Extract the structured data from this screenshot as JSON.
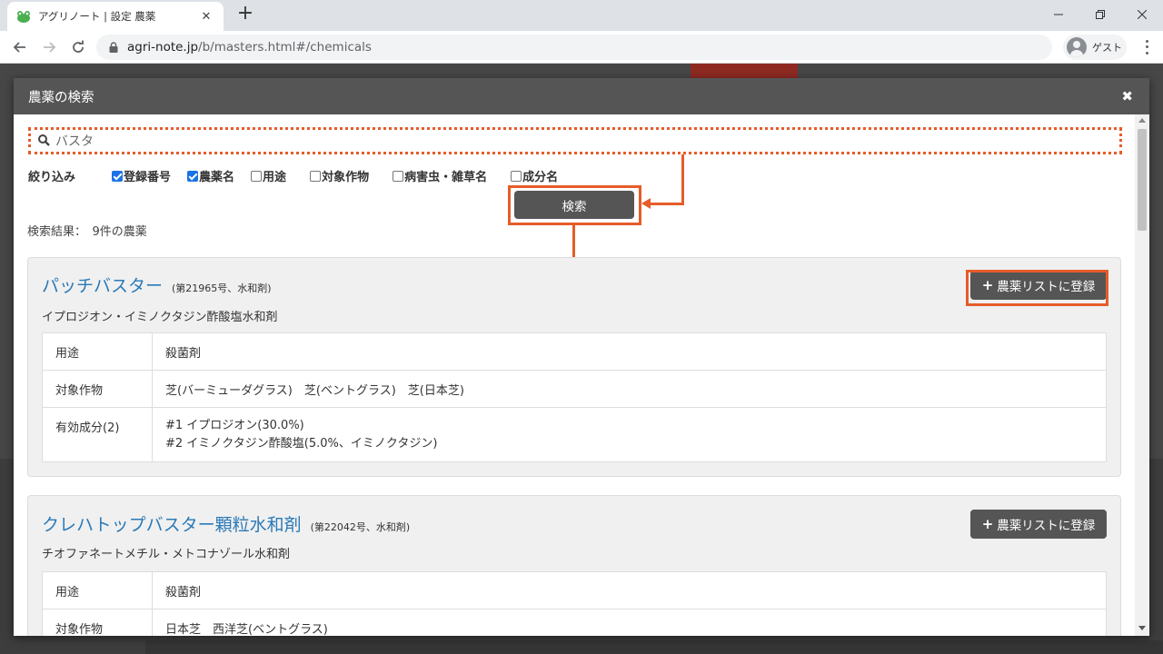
{
  "browser": {
    "tab_title": "アグリノート | 設定 農薬",
    "url_host": "agri-note.jp",
    "url_path": "/b/masters.html#/chemicals",
    "profile_label": "ゲスト"
  },
  "modal": {
    "title": "農薬の検索",
    "search_value": "バスタ",
    "filter_label": "絞り込み",
    "filters": [
      {
        "label": "登録番号",
        "checked": true
      },
      {
        "label": "農薬名",
        "checked": true
      },
      {
        "label": "用途",
        "checked": false
      },
      {
        "label": "対象作物",
        "checked": false
      },
      {
        "label": "病害虫・雑草名",
        "checked": false
      },
      {
        "label": "成分名",
        "checked": false
      }
    ],
    "search_button": "検索",
    "result_count": "検索結果：　9件の農薬",
    "add_button_label": "農薬リストに登録"
  },
  "results": [
    {
      "name": "パッチバスター",
      "registration": "(第21965号、水和剤)",
      "formulation": "イプロジオン・イミノクタジン酢酸塩水和剤",
      "rows": [
        {
          "key": "用途",
          "value": "殺菌剤"
        },
        {
          "key": "対象作物",
          "value": "芝(バーミューダグラス)　芝(ベントグラス)　芝(日本芝)"
        },
        {
          "key": "有効成分(2)",
          "value": "#1 イプロジオン(30.0%)",
          "value2": "#2 イミノクタジン酢酸塩(5.0%、イミノクタジン)"
        }
      ]
    },
    {
      "name": "クレハトップバスター顆粒水和剤",
      "registration": "(第22042号、水和剤)",
      "formulation": "チオファネートメチル・メトコナゾール水和剤",
      "rows": [
        {
          "key": "用途",
          "value": "殺菌剤"
        },
        {
          "key": "対象作物",
          "value": "日本芝　西洋芝(ベントグラス)"
        }
      ]
    }
  ]
}
